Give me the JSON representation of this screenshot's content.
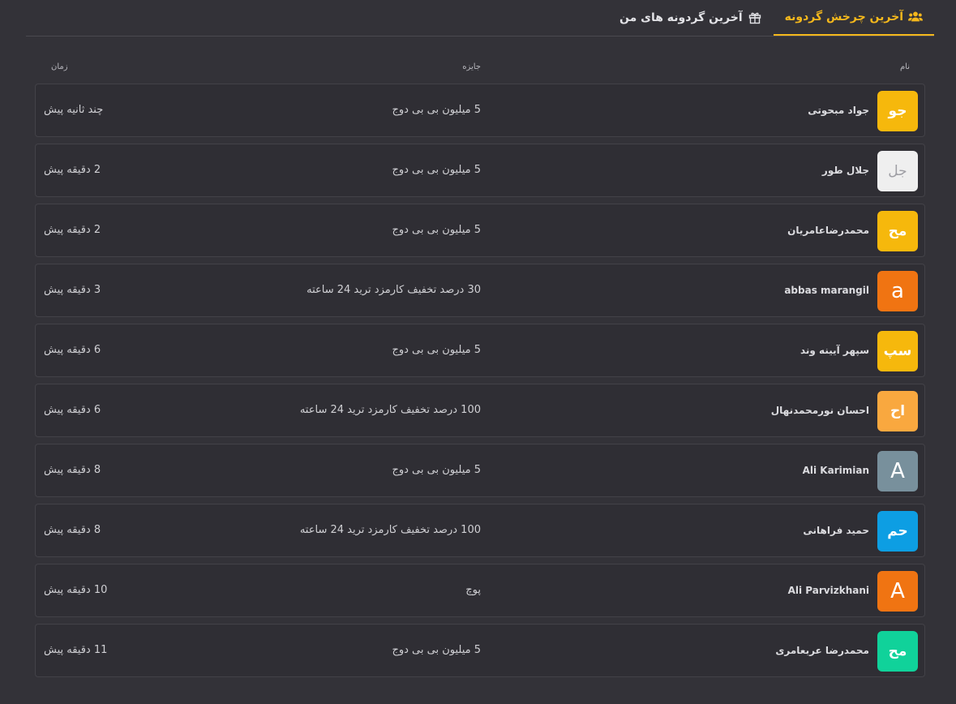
{
  "tabs": [
    {
      "label": "آخرین چرخش گردونه",
      "icon": "users-icon",
      "active": true
    },
    {
      "label": "آخرین گردونه های من",
      "icon": "gift-icon",
      "active": false
    }
  ],
  "table": {
    "headers": {
      "name": "نام",
      "prize": "جایزه",
      "time": "زمان"
    },
    "rows": [
      {
        "initials": "جو",
        "avatar_color": "#f6b80c",
        "name": "جواد مبحوتی",
        "prize": "5 میلیون بی بی دوج",
        "time": "چند ثانیه پیش"
      },
      {
        "initials": "جل",
        "avatar_color": "#efefef",
        "name": "جلال طور",
        "prize": "5 میلیون بی بی دوج",
        "time": "2 دقیقه پیش"
      },
      {
        "initials": "مح",
        "avatar_color": "#f6b80c",
        "name": "محمدرضاعامریان",
        "prize": "5 میلیون بی بی دوج",
        "time": "2 دقیقه پیش"
      },
      {
        "initials": "a",
        "avatar_color": "#f07412",
        "name": "abbas marangil",
        "prize": "30 درصد تخفیف کارمزد ترید 24 ساعته",
        "time": "3 دقیقه پیش"
      },
      {
        "initials": "سپ",
        "avatar_color": "#f6b80c",
        "name": "سپهر آیینه وند",
        "prize": "5 میلیون بی بی دوج",
        "time": "6 دقیقه پیش"
      },
      {
        "initials": "اح",
        "avatar_color": "#f9a83f",
        "name": "احسان نورمحمدنهال",
        "prize": "100 درصد تخفیف کارمزد ترید 24 ساعته",
        "time": "6 دقیقه پیش"
      },
      {
        "initials": "A",
        "avatar_color": "#78909c",
        "name": "Ali Karimian",
        "prize": "5 میلیون بی بی دوج",
        "time": "8 دقیقه پیش"
      },
      {
        "initials": "حم",
        "avatar_color": "#0d9ee3",
        "name": "حمید فراهانی",
        "prize": "100 درصد تخفیف کارمزد ترید 24 ساعته",
        "time": "8 دقیقه پیش"
      },
      {
        "initials": "A",
        "avatar_color": "#f07412",
        "name": "Ali Parvizkhani",
        "prize": "پوچ",
        "time": "10 دقیقه پیش"
      },
      {
        "initials": "مح",
        "avatar_color": "#10d29a",
        "name": "محمدرضا عربعامری",
        "prize": "5 میلیون بی بی دوج",
        "time": "11 دقیقه پیش"
      }
    ]
  },
  "colors": {
    "accent": "#f5b81c",
    "background": "#333238",
    "row_border": "#434248"
  }
}
